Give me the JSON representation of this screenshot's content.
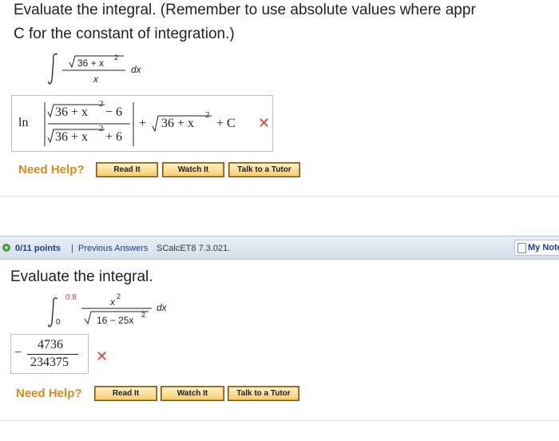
{
  "question1": {
    "instruction_line1": "Evaluate the integral. (Remember to use absolute values where appr",
    "instruction_line2": "C for the constant of integration.)",
    "integral": {
      "radicand": "36 + x",
      "exponent": "2",
      "differential": "dx",
      "denominator": "x"
    },
    "answer": {
      "ln": "ln",
      "frac_num": "36 + x",
      "frac_num_tail": " − 6",
      "frac_den": "36 + x",
      "frac_den_tail": " + 6",
      "plus": "+",
      "sqrt_term": "36 + x",
      "exponent": "2",
      "constant": "+ C"
    },
    "status_icon": "✕",
    "help": {
      "label": "Need Help?",
      "read": "Read It",
      "watch": "Watch It",
      "tutor": "Talk to a Tutor"
    }
  },
  "question2": {
    "bar": {
      "points": "0/11 points",
      "separator": "|",
      "previous_answers": "Previous Answers",
      "code": "SCalcET8 7.3.021.",
      "my_notes": "My Note"
    },
    "instruction": "Evaluate the integral.",
    "integral": {
      "upper": "0.8",
      "lower": "0",
      "numerator": "x",
      "num_exp": "2",
      "radicand": "16 − 25x",
      "rad_exp": "2",
      "differential": "dx"
    },
    "answer": {
      "sign": "−",
      "numerator": "4736",
      "denominator": "234375"
    },
    "status_icon": "✕",
    "help": {
      "label": "Need Help?",
      "read": "Read It",
      "watch": "Watch It",
      "tutor": "Talk to a Tutor"
    }
  },
  "colors": {
    "wrong": "#e0393e",
    "need_help": "#d98a1c",
    "link_blue": "#1d3f8a",
    "button_fill": "#f7cf72"
  }
}
